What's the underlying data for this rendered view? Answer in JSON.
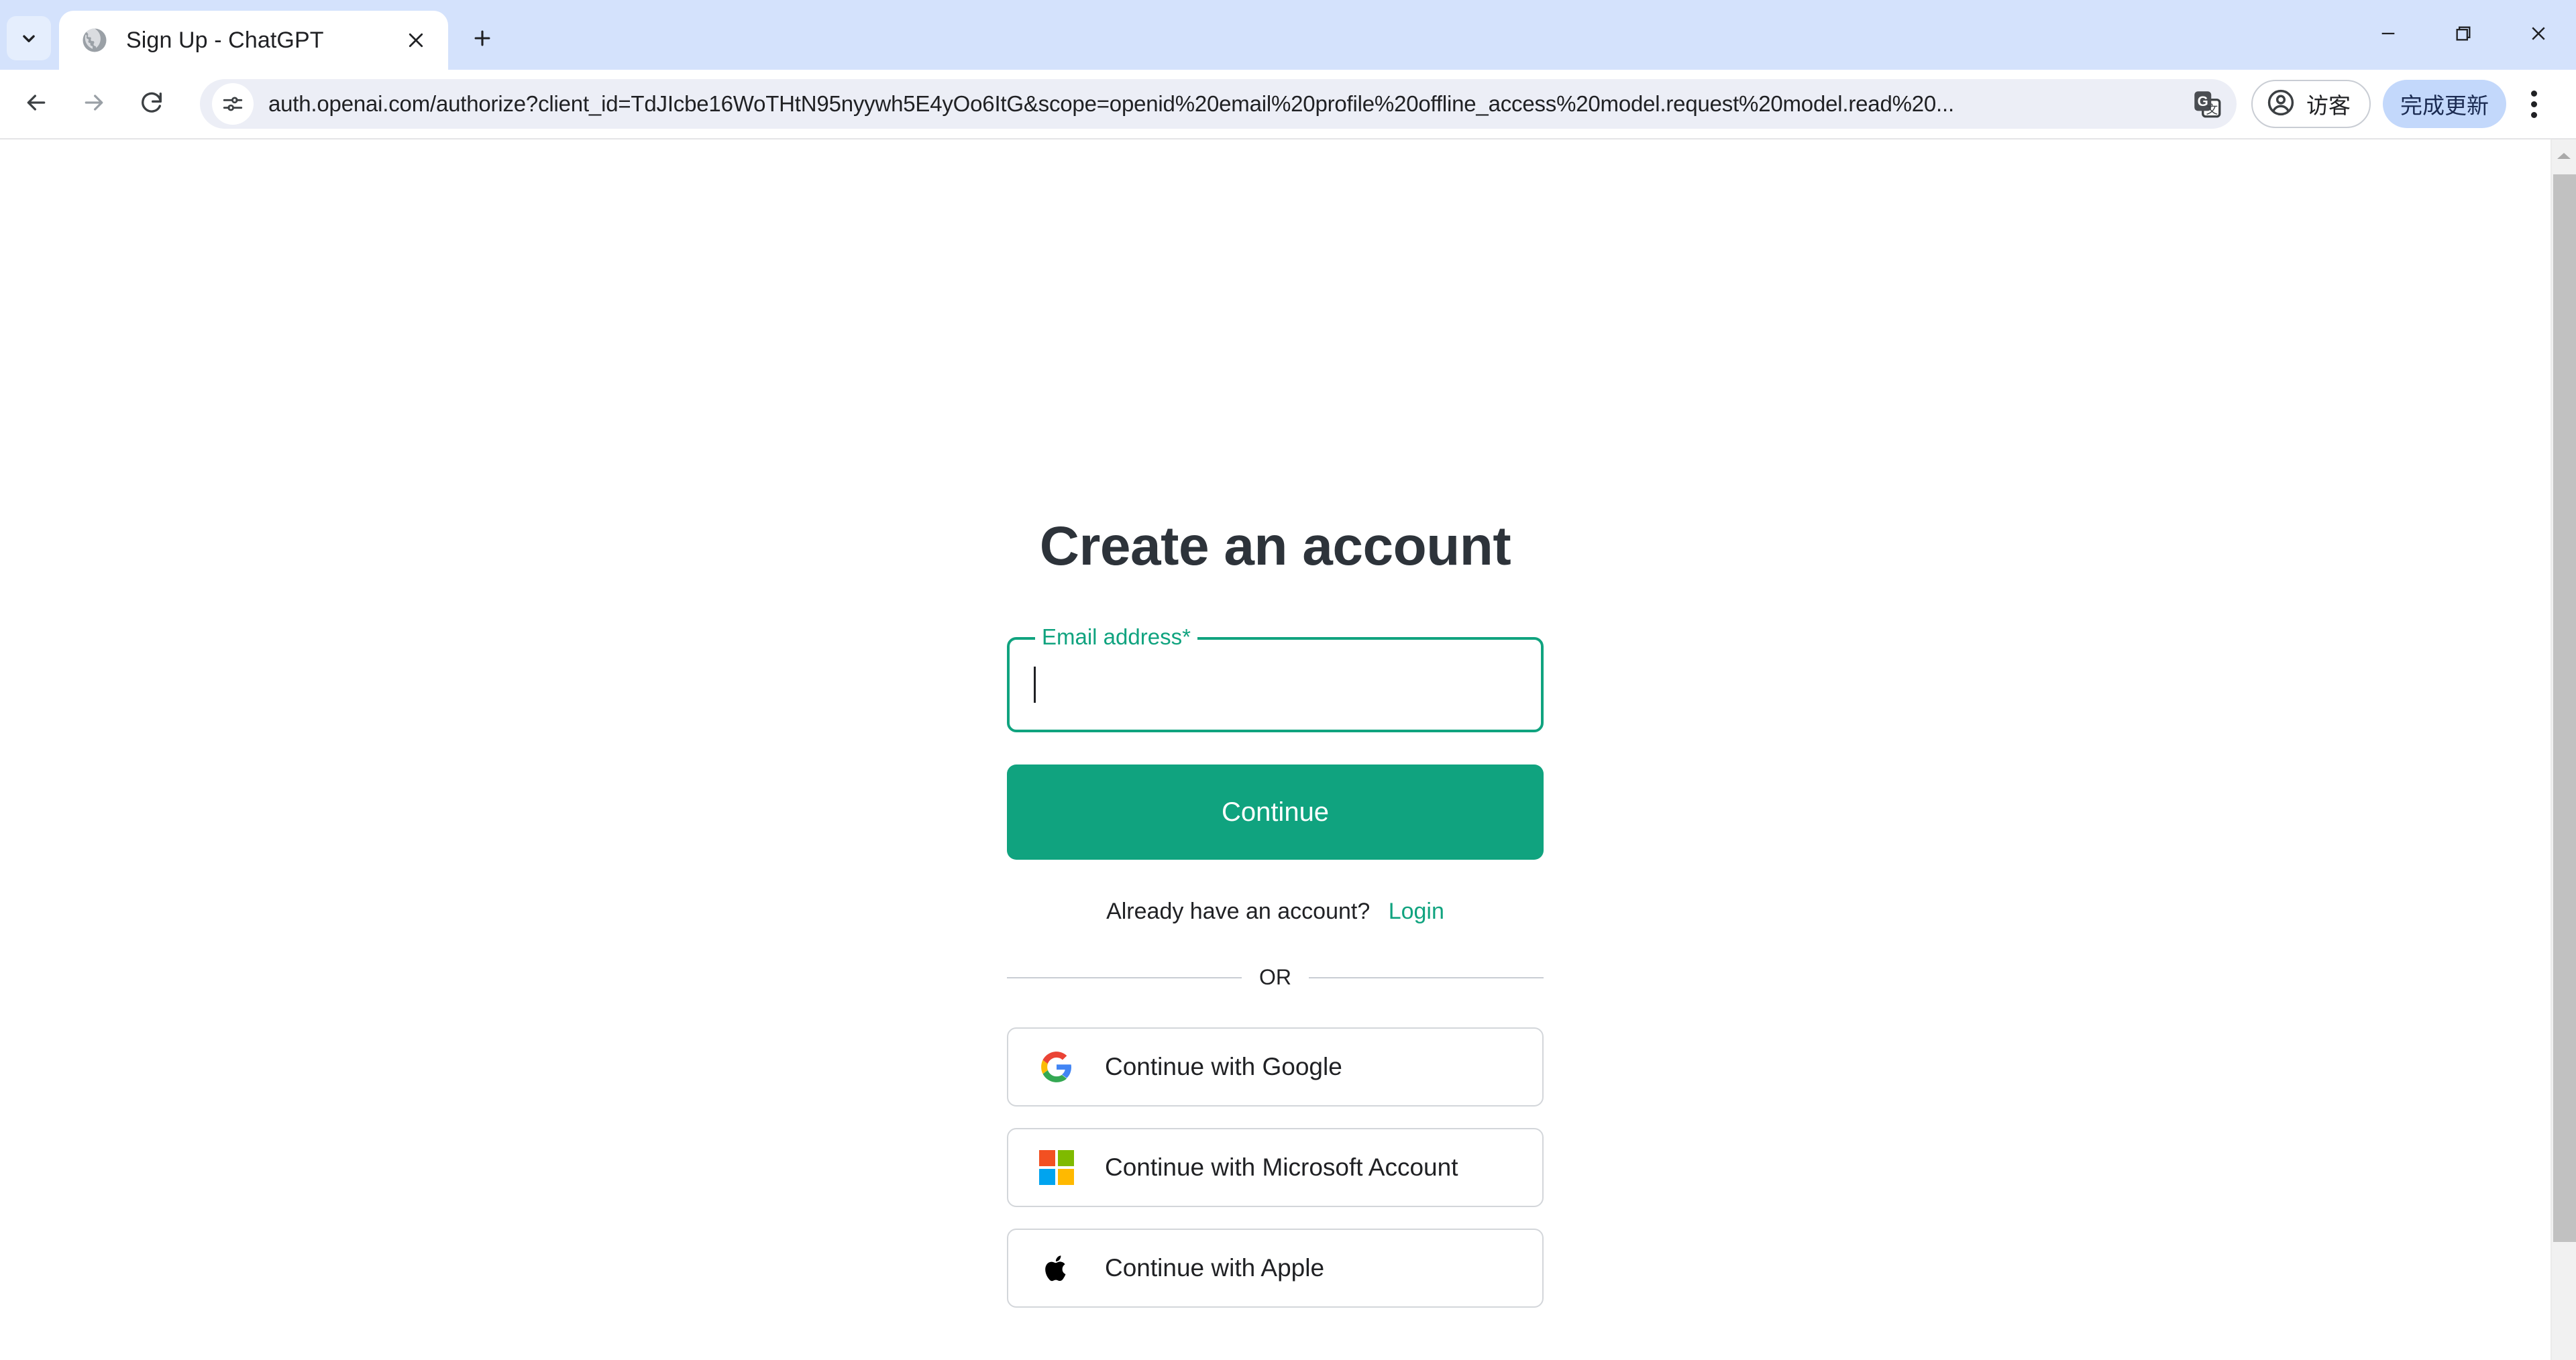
{
  "browser": {
    "tab_search_icon": "chevron-down-icon",
    "tabs": [
      {
        "title": "Sign Up - ChatGPT",
        "favicon": "globe-icon",
        "close_icon": "close-icon",
        "active": true
      }
    ],
    "new_tab_icon": "plus-icon",
    "window_controls": {
      "minimize": "minimize-icon",
      "maximize": "restore-icon",
      "close": "close-icon"
    },
    "nav": {
      "back_icon": "arrow-left-icon",
      "forward_icon": "arrow-right-icon",
      "reload_icon": "reload-icon"
    },
    "omnibox": {
      "site_info_icon": "site-settings-icon",
      "url": "auth.openai.com/authorize?client_id=TdJIcbe16WoTHtN95nyywh5E4yOo6ItG&scope=openid%20email%20profile%20offline_access%20model.request%20model.read%20...",
      "placeholder": "Search Google or type a URL",
      "translate_icon": "translate-icon"
    },
    "profile": {
      "label": "访客",
      "icon": "account-circle-icon"
    },
    "update_button": {
      "label": "完成更新"
    },
    "menu_icon": "more-vertical-icon",
    "colors": {
      "tabstrip_bg": "#d4e2fc",
      "omnibox_bg": "#eceef6",
      "update_bg": "#c3d8fb"
    }
  },
  "page": {
    "title": "Create an account",
    "email_field": {
      "label": "Email address*",
      "value": "",
      "placeholder": "",
      "focused": true
    },
    "continue_button": {
      "label": "Continue"
    },
    "already_account": {
      "text": "Already have an account?",
      "link_label": "Login"
    },
    "divider_label": "OR",
    "social_buttons": [
      {
        "label": "Continue with Google",
        "icon": "google-icon"
      },
      {
        "label": "Continue with Microsoft Account",
        "icon": "microsoft-icon"
      },
      {
        "label": "Continue with Apple",
        "icon": "apple-icon"
      }
    ],
    "colors": {
      "accent": "#10a37f",
      "title": "#2d333a",
      "border": "#d3d6da"
    }
  },
  "scrollbar": {
    "up_arrow_icon": "caret-up-icon"
  }
}
